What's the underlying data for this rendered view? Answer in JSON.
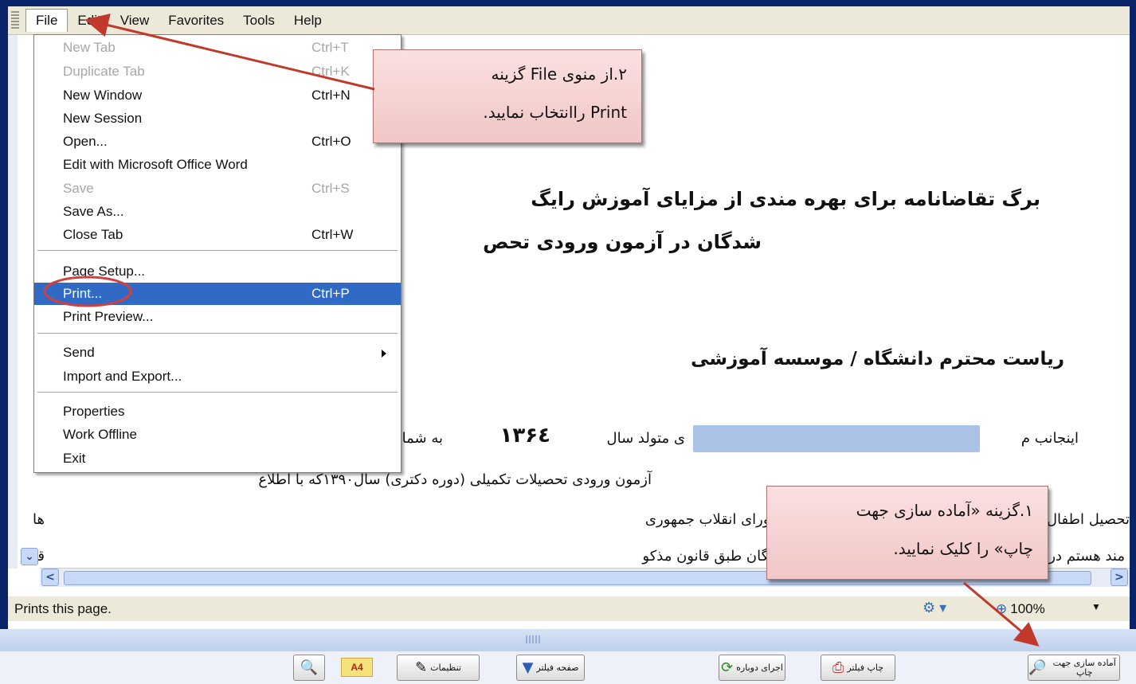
{
  "menubar": {
    "items": [
      "File",
      "Edit",
      "View",
      "Favorites",
      "Tools",
      "Help"
    ]
  },
  "file_menu": {
    "items": [
      {
        "label": "New Tab",
        "shortcut": "Ctrl+T"
      },
      {
        "label": "Duplicate Tab",
        "shortcut": "Ctrl+K"
      },
      {
        "label": "New Window",
        "shortcut": "Ctrl+N"
      },
      {
        "label": "New Session",
        "shortcut": ""
      },
      {
        "label": "Open...",
        "shortcut": "Ctrl+O"
      },
      {
        "label": "Edit with Microsoft Office Word",
        "shortcut": ""
      },
      {
        "label": "Save",
        "shortcut": "Ctrl+S"
      },
      {
        "label": "Save As...",
        "shortcut": ""
      },
      {
        "label": "Close Tab",
        "shortcut": "Ctrl+W"
      },
      {
        "label": "Page Setup...",
        "shortcut": ""
      },
      {
        "label": "Print...",
        "shortcut": "Ctrl+P"
      },
      {
        "label": "Print Preview...",
        "shortcut": ""
      },
      {
        "label": "Send",
        "shortcut": ""
      },
      {
        "label": "Import and Export...",
        "shortcut": ""
      },
      {
        "label": "Properties",
        "shortcut": ""
      },
      {
        "label": "Work Offline",
        "shortcut": ""
      },
      {
        "label": "Exit",
        "shortcut": ""
      }
    ]
  },
  "document": {
    "heading_line1": "برگ تقاضانامه برای بهره مندی از مزایای آموزش رایگ",
    "heading_line2": "شدگان در آزمون ورودی تحص",
    "salutation": "ریاست محترم دانشگاه / موسسه آموزشی",
    "line_applicant_start": "اینجانب م",
    "line_applicant_born": "ی   متولد سال",
    "birth_year": "۱۳۶٤",
    "line_applicant_num": "به شما",
    "line_exam": "آزمون ورودی تحصیلات تکمیلی (دوره دکتری) سال۱۳۹۰که با اطلاع",
    "line_law": "تحصیل اطفال و جوانان ایرانی که در جلسه مورخ ۵۹/۳/۱۲ شورای انقلاب جمهوری",
    "line_law_prefix": "ها",
    "line_benefit": "مند هستم در طول تحصیل دوره دکتری از مزایای آموزش رایگان طبق قانون مذکو",
    "line_benefit_prefix": "قب"
  },
  "callouts": {
    "step2_line1": "۲.از منوی File گزینه",
    "step2_line2": "Print راانتخاب نمایید.",
    "step1_line1": "۱.گزینه «آماده سازی جهت",
    "step1_line2": "چاپ» را کلیک نمایید."
  },
  "statusbar": {
    "text": "Prints this page.",
    "zoom": "100%"
  },
  "toolbar": {
    "prepare_print": "آماده سازی جهت چاپ",
    "print_filter": "چاپ فیلتر",
    "rerun": "اجرای دوباره",
    "filter_page": "صفحه فیلتر",
    "settings": "تنظیمات",
    "a4": "A4"
  },
  "icons": [
    "search-icon",
    "settings-icon",
    "filter-icon",
    "refresh-icon",
    "printer-icon",
    "internet-zone-icon",
    "zoom-icon"
  ]
}
